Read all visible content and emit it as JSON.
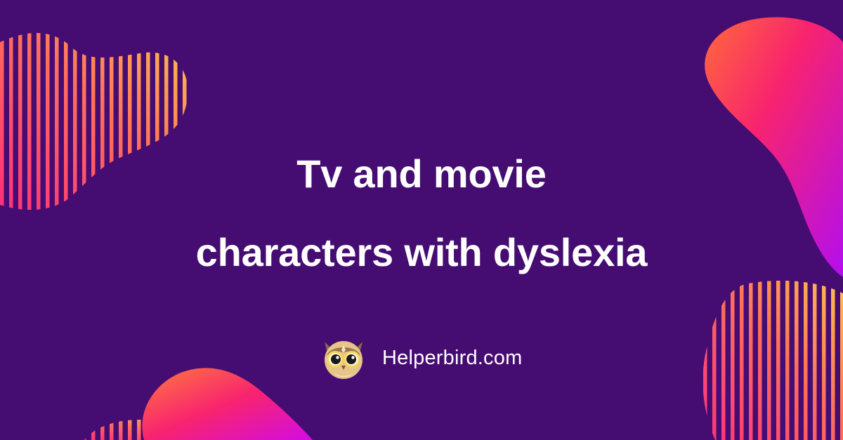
{
  "headline": {
    "line1": "Tv and movie",
    "line2": "characters with dyslexia"
  },
  "brand": {
    "name": "Helperbird.com",
    "logo_icon": "owl-icon"
  },
  "colors": {
    "background": "#450c72",
    "accent_pink": "#f8236f",
    "accent_magenta": "#d20ce4",
    "accent_orange": "#ffb04b",
    "text": "#ffffff"
  }
}
